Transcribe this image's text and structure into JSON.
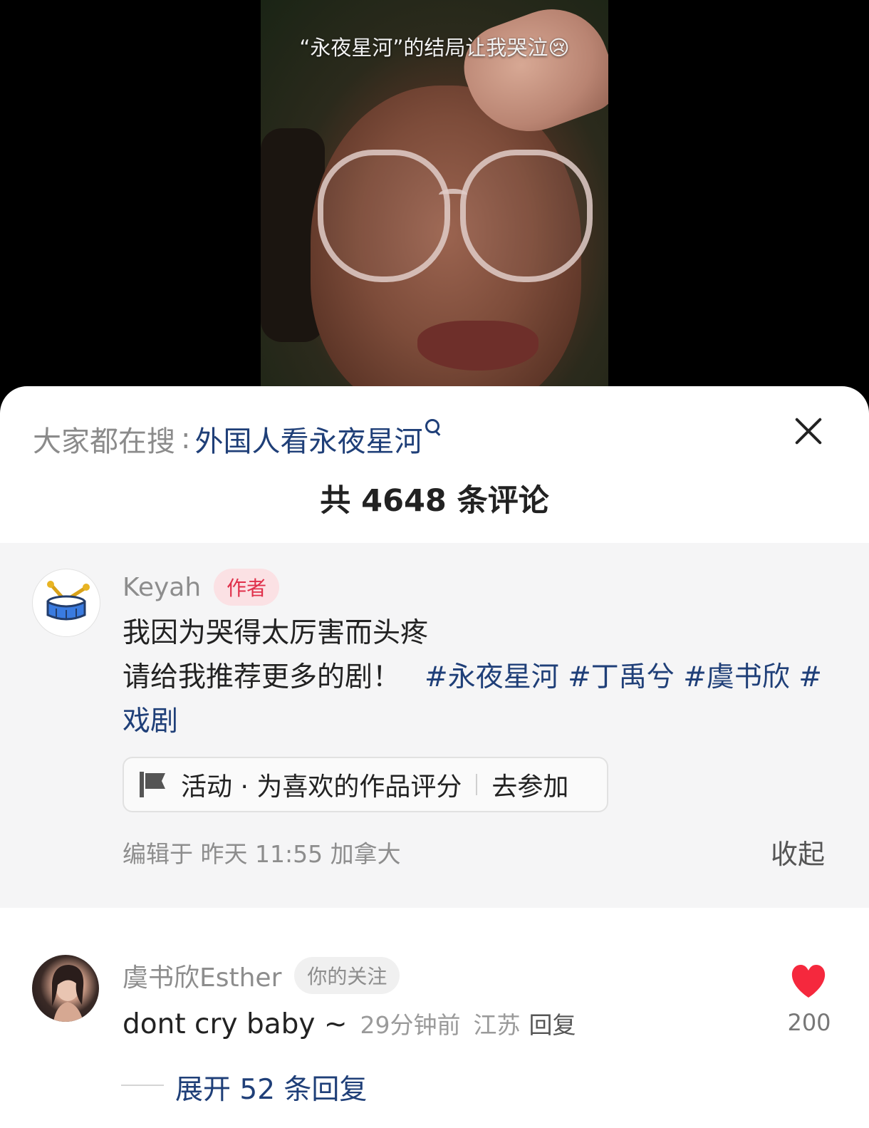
{
  "video": {
    "caption": "“永夜星河”的结局让我哭泣😢"
  },
  "sheet": {
    "search_prefix": "大家都在搜",
    "search_colon": ":",
    "search_term": "外国人看永夜星河",
    "comment_count": "共 4648 条评论"
  },
  "author_comment": {
    "name": "Keyah",
    "badge": "作者",
    "line1": "我因为哭得太厉害而头疼",
    "line2_text": "请给我推荐更多的剧！",
    "hashtags": [
      "#永夜星河",
      "#丁禹兮",
      "#虞书欣",
      "#戏剧"
    ],
    "activity_label": "活动 · 为喜欢的作品评分",
    "activity_action": "去参加",
    "edit_meta": "编辑于 昨天 11:55 加拿大",
    "collapse": "收起"
  },
  "reply_comment": {
    "name": "虞书欣Esther",
    "badge": "你的关注",
    "text": "dont cry baby ~",
    "time": "29分钟前",
    "location": "江苏",
    "reply_action": "回复",
    "likes": "200",
    "expand": "展开 52 条回复"
  },
  "colors": {
    "link": "#1f3f78",
    "badge_red": "#e0304a",
    "heart": "#f5283d"
  },
  "icons": [
    "search-icon",
    "close-icon",
    "drum-icon",
    "flag-icon",
    "heart-icon"
  ]
}
